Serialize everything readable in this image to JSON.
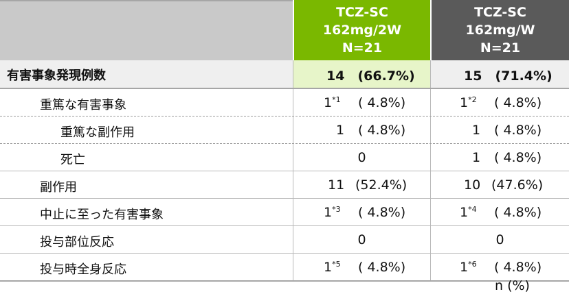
{
  "header": {
    "col1": {
      "line1": "TCZ-SC",
      "line2": "162mg/2W",
      "line3": "N=21",
      "color": "#7ab800"
    },
    "col2": {
      "line1": "TCZ-SC",
      "line2": "162mg/W",
      "line3": "N=21",
      "color": "#5a5a5a"
    }
  },
  "summary": {
    "label": "有害事象発現例数",
    "col1": "14　(66.7%)",
    "col2": "15　(71.4%)"
  },
  "rows": [
    {
      "label": "重篤な有害事象",
      "col1": {
        "n": "1",
        "fn": "*1",
        "pct": "( 4.8%)"
      },
      "col2": {
        "n": "1",
        "fn": "*2",
        "pct": "( 4.8%)"
      }
    },
    {
      "label": "重篤な副作用",
      "col1": {
        "n": "1",
        "fn": "",
        "pct": "( 4.8%)"
      },
      "col2": {
        "n": "1",
        "fn": "",
        "pct": "( 4.8%)"
      }
    },
    {
      "label": "死亡",
      "col1": {
        "n": "0"
      },
      "col2": {
        "n": "1",
        "fn": "",
        "pct": "( 4.8%)"
      }
    },
    {
      "label": "副作用",
      "col1": {
        "n": "11",
        "pct": "(52.4%)"
      },
      "col2": {
        "n": "10",
        "pct": "(47.6%)"
      }
    },
    {
      "label": "中止に至った有害事象",
      "col1": {
        "n": "1",
        "fn": "*3",
        "pct": "( 4.8%)"
      },
      "col2": {
        "n": "1",
        "fn": "*4",
        "pct": "( 4.8%)"
      }
    },
    {
      "label": "投与部位反応",
      "col1": {
        "n": "0"
      },
      "col2": {
        "n": "0"
      }
    },
    {
      "label": "投与時全身反応",
      "col1": {
        "n": "1",
        "fn": "*5",
        "pct": "( 4.8%)"
      },
      "col2": {
        "n": "1",
        "fn": "*6",
        "pct": "( 4.8%)"
      }
    }
  ],
  "unit_note": "n (%)"
}
